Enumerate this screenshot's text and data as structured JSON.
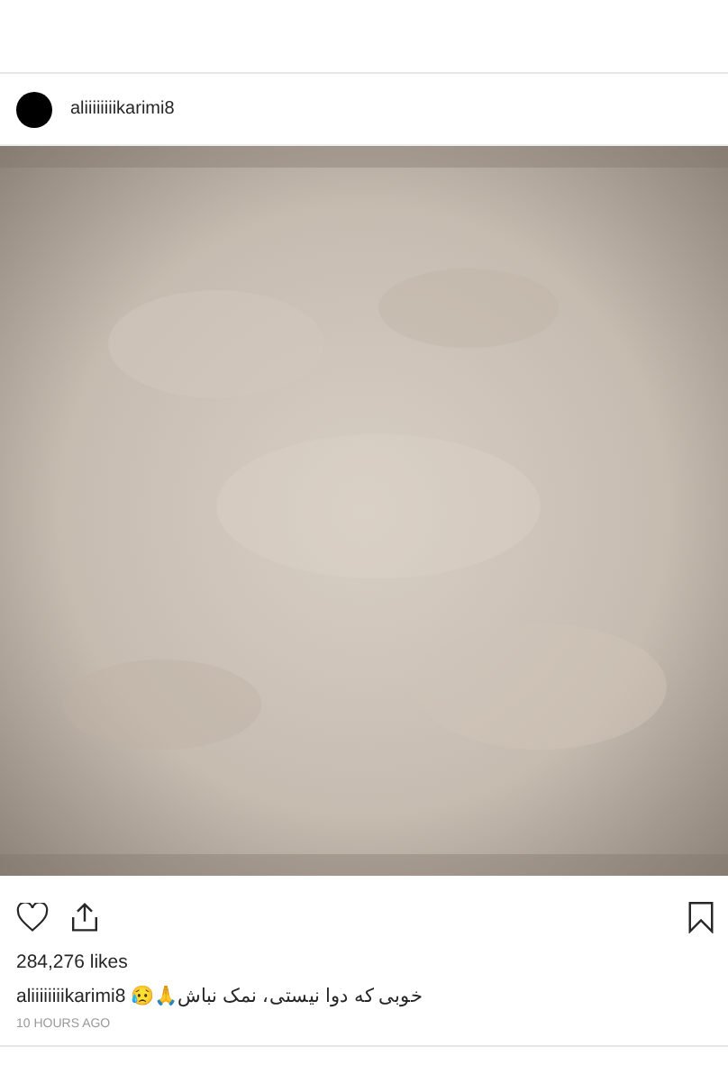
{
  "post": {
    "username": "aliiiiiiiikarimi8",
    "liked": false,
    "saved": false,
    "likes": "284,276 likes",
    "caption": {
      "username": "aliiiiiiiikarimi8",
      "text": "خوبی که دوا نیستی، نمک نباش🙏😥"
    },
    "time": "10 HOURS AGO"
  }
}
